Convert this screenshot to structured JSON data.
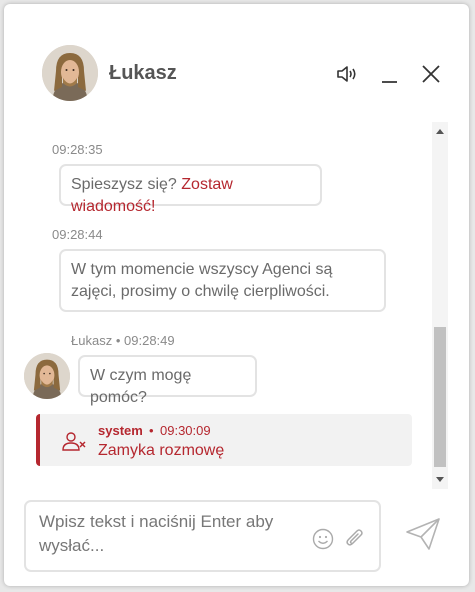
{
  "header": {
    "agent_name": "Łukasz",
    "sound_icon": "speaker-icon",
    "minimize_icon": "minimize-icon",
    "close_icon": "close-icon"
  },
  "messages": [
    {
      "time": "09:28:35",
      "text": "Spieszysz się? ",
      "link": "Zostaw wiadomość!"
    },
    {
      "time": "09:28:44",
      "text": "W tym momencie wszyscy Agenci są zajęci, prosimy o chwilę cierpliwości."
    },
    {
      "author": "Łukasz",
      "separator": "•",
      "time": "09:28:49",
      "text": "W czym mogę pomóc?"
    }
  ],
  "system_message": {
    "author": "system",
    "separator": "•",
    "time": "09:30:09",
    "text": "Zamyka rozmowę",
    "icon": "user-removed-icon"
  },
  "composer": {
    "placeholder": "Wpisz tekst i naciśnij Enter aby wysłać...",
    "emoji_icon": "emoji-icon",
    "attach_icon": "paperclip-icon",
    "send_icon": "paper-plane-icon"
  },
  "colors": {
    "accent": "#b5272f",
    "text": "#6a6a6a",
    "border": "#e3e3e3"
  }
}
